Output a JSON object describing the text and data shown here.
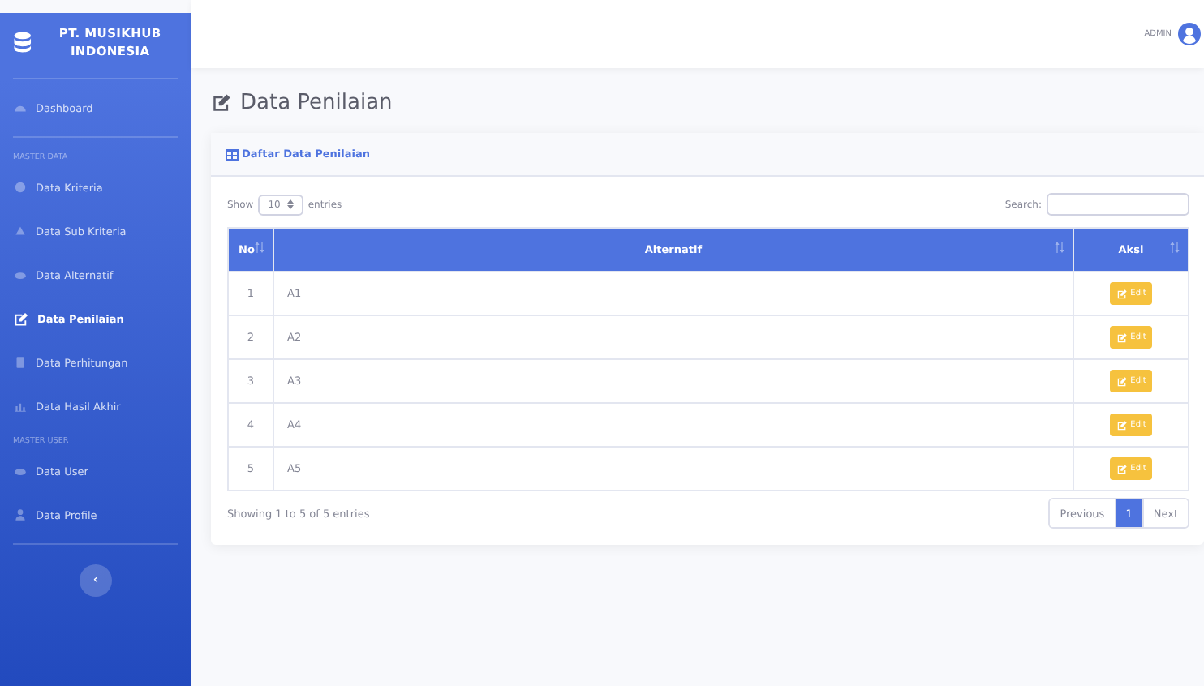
{
  "brand": {
    "name": "PT. MUSIKHUB INDONESIA"
  },
  "sidebar": {
    "items": [
      {
        "kind": "link",
        "label": "Dashboard",
        "selected": false
      },
      {
        "kind": "heading",
        "label": "MASTER DATA"
      },
      {
        "kind": "link",
        "label": "Data Kriteria",
        "selected": false
      },
      {
        "kind": "link",
        "label": "Data Sub Kriteria",
        "selected": false
      },
      {
        "kind": "link",
        "label": "Data Alternatif",
        "selected": false
      },
      {
        "kind": "link",
        "label": "Data Penilaian",
        "selected": true
      },
      {
        "kind": "link",
        "label": "Data Perhitungan",
        "selected": false
      },
      {
        "kind": "link",
        "label": "Data Hasil Akhir",
        "selected": false
      },
      {
        "kind": "heading",
        "label": "MASTER USER"
      },
      {
        "kind": "link",
        "label": "Data User",
        "selected": false
      },
      {
        "kind": "link",
        "label": "Data Profile",
        "selected": false
      }
    ],
    "collapse_button": "‹"
  },
  "topbar": {
    "user": "ADMIN"
  },
  "page_title": "Data Penilaian",
  "card": {
    "title": "Daftar Data Penilaian",
    "length": {
      "prefix": "Show",
      "value": "10",
      "suffix": "entries"
    },
    "search": {
      "label": "Search:"
    },
    "table": {
      "columns": [
        {
          "label": "No"
        },
        {
          "label": "Alternatif"
        },
        {
          "label": "Aksi"
        }
      ],
      "rows": [
        {
          "no": "1",
          "alternatif": "A1",
          "action": "Edit"
        },
        {
          "no": "2",
          "alternatif": "A2",
          "action": "Edit"
        },
        {
          "no": "3",
          "alternatif": "A3",
          "action": "Edit"
        },
        {
          "no": "4",
          "alternatif": "A4",
          "action": "Edit"
        },
        {
          "no": "5",
          "alternatif": "A5",
          "action": "Edit"
        }
      ]
    },
    "info": "Showing 1 to 5 of 5 entries",
    "pagination": [
      {
        "label": "Previous",
        "selected": false
      },
      {
        "label": "1",
        "selected": true
      },
      {
        "label": "Next",
        "selected": false
      }
    ]
  }
}
